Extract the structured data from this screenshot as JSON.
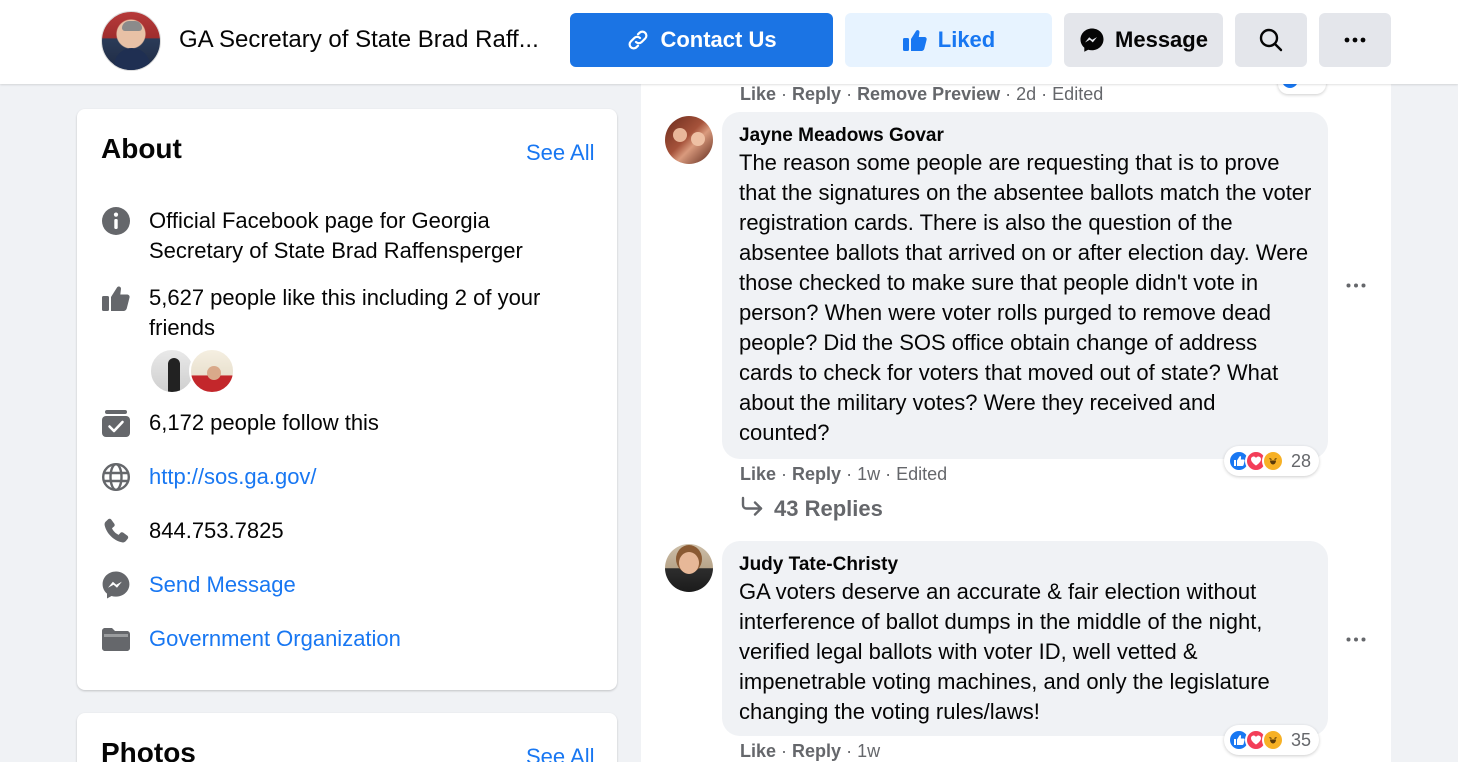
{
  "header": {
    "page_name": "GA Secretary of State Brad Raff...",
    "contact_label": "Contact Us",
    "liked_label": "Liked",
    "message_label": "Message"
  },
  "about": {
    "title": "About",
    "see_all": "See All",
    "description": "Official Facebook page for Georgia Secretary of State Brad Raffensperger",
    "likes": "5,627 people like this including 2 of your friends",
    "follows": "6,172 people follow this",
    "website": "http://sos.ga.gov/",
    "phone": "844.753.7825",
    "send_message": "Send Message",
    "category": "Government Organization"
  },
  "photos": {
    "title": "Photos",
    "see_all": "See All"
  },
  "feed": {
    "prev_meta": {
      "like": "Like",
      "reply": "Reply",
      "remove_preview": "Remove Preview",
      "time": "2d",
      "edited": "Edited"
    },
    "comments": [
      {
        "author": "Jayne Meadows Govar",
        "text": "The reason some people are requesting that is to prove that the signatures on the absentee ballots match the voter registration cards. There is also the question of the absentee ballots that arrived on or after election day. Were those checked to make sure that people didn't vote in person? When were voter rolls purged to remove dead people? Did the SOS office obtain change of address cards to check for voters that moved out of state? What about the military votes? Were they received and counted?",
        "like": "Like",
        "reply": "Reply",
        "time": "1w",
        "edited": "Edited",
        "reaction_count": "28",
        "replies_label": "43 Replies"
      },
      {
        "author": "Judy Tate-Christy",
        "text": "GA voters deserve an accurate & fair election without interference of ballot dumps in the middle of the night, verified legal ballots with voter ID, well vetted & impenetrable voting machines, and only the legislature changing the voting rules/laws!",
        "like": "Like",
        "reply": "Reply",
        "time": "1w",
        "reaction_count": "35"
      }
    ]
  },
  "colors": {
    "accent": "#1877f2",
    "primary_button": "#1b74e4",
    "liked_bg": "#e7f3ff",
    "secondary_button": "#e4e6eb",
    "bubble": "#f0f2f5",
    "muted_text": "#65676b"
  }
}
